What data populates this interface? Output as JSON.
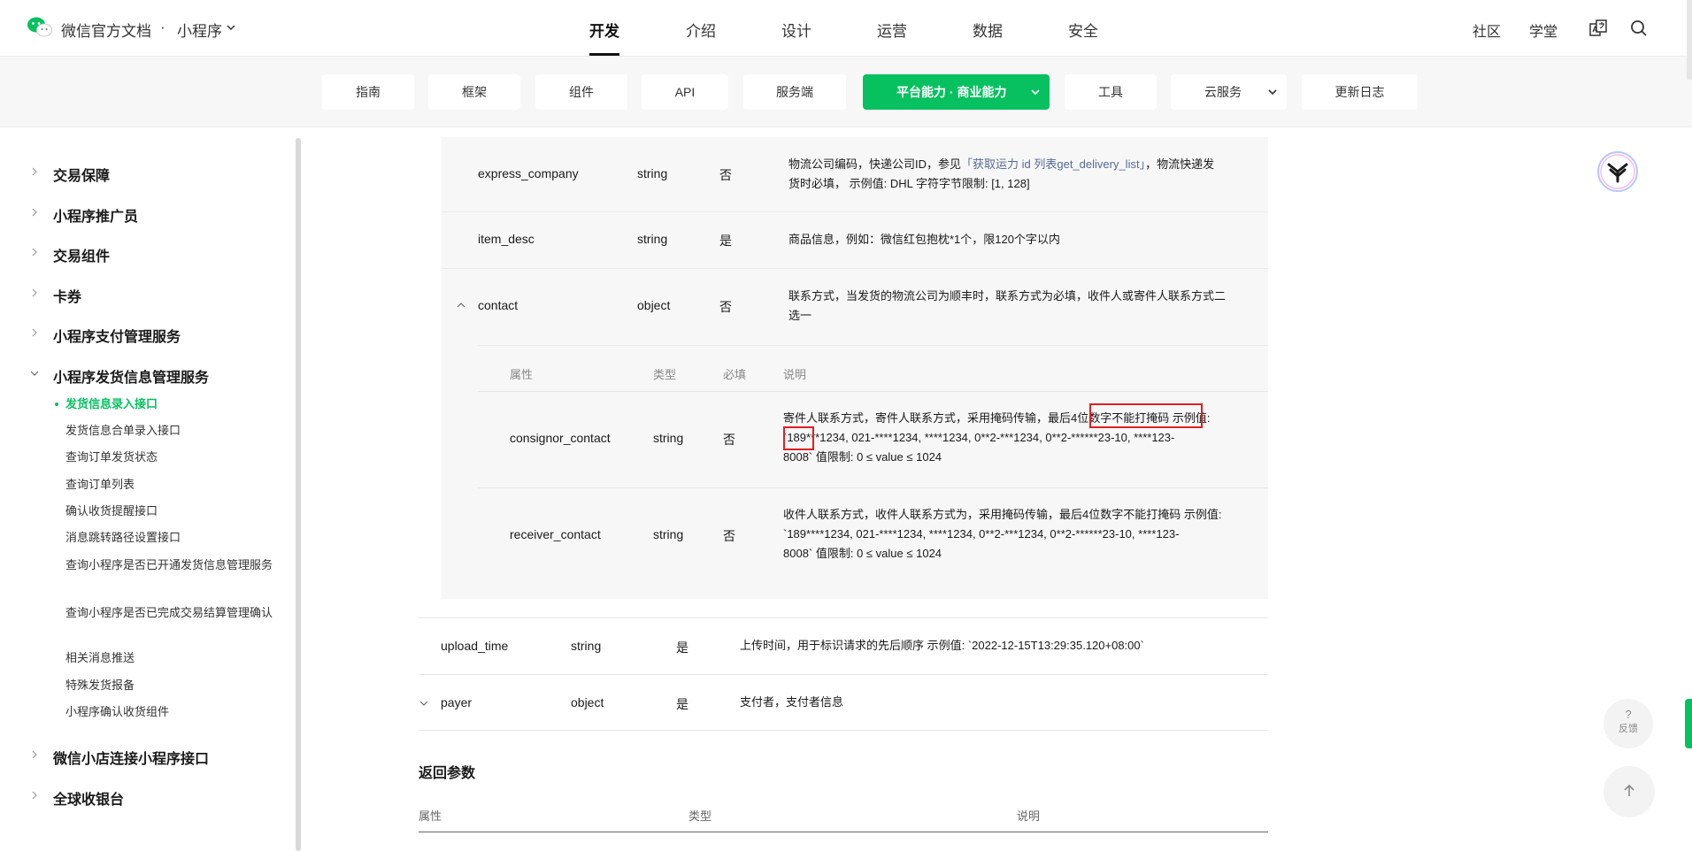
{
  "header": {
    "brand": "微信官方文档",
    "separator": "·",
    "product": "小程序",
    "nav": [
      {
        "label": "开发",
        "active": true
      },
      {
        "label": "介绍"
      },
      {
        "label": "设计"
      },
      {
        "label": "运营"
      },
      {
        "label": "数据"
      },
      {
        "label": "安全"
      }
    ],
    "right_links": [
      "社区",
      "学堂"
    ],
    "icons": [
      "translate-icon",
      "search-icon"
    ]
  },
  "subnav": [
    {
      "label": "指南"
    },
    {
      "label": "框架"
    },
    {
      "label": "组件"
    },
    {
      "label": "API"
    },
    {
      "label": "服务端"
    },
    {
      "label": "平台能力 · 商业能力",
      "active": true,
      "dropdown": true
    },
    {
      "label": "工具"
    },
    {
      "label": "云服务",
      "dropdown": true
    },
    {
      "label": "更新日志"
    }
  ],
  "sidebar": {
    "sections": [
      {
        "label": "交易保障"
      },
      {
        "label": "小程序推广员"
      },
      {
        "label": "交易组件"
      },
      {
        "label": "卡券"
      },
      {
        "label": "小程序支付管理服务"
      },
      {
        "label": "小程序发货信息管理服务",
        "expanded": true
      }
    ],
    "sub_items": [
      {
        "label": "发货信息录入接口",
        "active": true
      },
      {
        "label": "发货信息合单录入接口"
      },
      {
        "label": "查询订单发货状态"
      },
      {
        "label": "查询订单列表"
      },
      {
        "label": "确认收货提醒接口"
      },
      {
        "label": "消息跳转路径设置接口"
      },
      {
        "label": "查询小程序是否已开通发货信息管理服务"
      },
      {
        "label": "查询小程序是否已完成交易结算管理确认"
      },
      {
        "label": "相关消息推送"
      },
      {
        "label": "特殊发货报备"
      },
      {
        "label": "小程序确认收货组件"
      }
    ],
    "after_sections": [
      {
        "label": "微信小店连接小程序接口"
      },
      {
        "label": "全球收银台"
      }
    ]
  },
  "table": {
    "rows": [
      {
        "name": "express_company",
        "type": "string",
        "required": "否",
        "desc_pre": "物流公司编码，快递公司ID，参见",
        "desc_link": "「获取运力 id 列表get_delivery_list」",
        "desc_post": "，物流快递发",
        "desc_line2": "货时必填， 示例值: DHL 字符字节限制: [1, 128]"
      },
      {
        "name": "item_desc",
        "type": "string",
        "required": "是",
        "desc": "商品信息，例如：微信红包抱枕*1个，限120个字以内"
      },
      {
        "name": "contact",
        "type": "object",
        "required": "否",
        "desc_line1": "联系方式，当发货的物流公司为顺丰时，联系方式为必填，收件人或寄件人联系方式二",
        "desc_line2": "选一"
      }
    ],
    "nested_headers": [
      "属性",
      "类型",
      "必填",
      "说明"
    ],
    "nested_rows": [
      {
        "name": "consignor_contact",
        "type": "string",
        "required": "否",
        "desc_line1_a": "寄件人联系方式，寄件人联系方式，采用掩码传输，最后",
        "desc_line1_highlight": "4位数字不能打掩码",
        "desc_line1_b": " 示例值:",
        "desc_line2_highlight": "`189",
        "desc_line2_rest": "***1234, 021-****1234, ****1234, 0**2-***1234, 0**2-******23-10, ****123-",
        "desc_line3": "8008` 值限制: 0 ≤ value ≤ 1024"
      },
      {
        "name": "receiver_contact",
        "type": "string",
        "required": "否",
        "desc_line1": "收件人联系方式，收件人联系方式为，采用掩码传输，最后4位数字不能打掩码 示例值:",
        "desc_line2": "`189****1234, 021-****1234, ****1234, 0**2-***1234, 0**2-******23-10, ****123-",
        "desc_line3": "8008` 值限制: 0 ≤ value ≤ 1024"
      }
    ],
    "outer_rows": [
      {
        "name": "upload_time",
        "type": "string",
        "required": "是",
        "desc": "上传时间，用于标识请求的先后顺序 示例值: `2022-12-15T13:29:35.120+08:00`"
      },
      {
        "name": "payer",
        "type": "object",
        "required": "是",
        "desc": "支付者，支付者信息"
      }
    ]
  },
  "return_params": {
    "title": "返回参数",
    "headers": [
      "属性",
      "类型",
      "说明"
    ]
  },
  "widgets": {
    "feedback_q": "?",
    "feedback_label": "反馈"
  },
  "colors": {
    "accent": "#07c160",
    "link": "#576b95",
    "highlight_box": "#e02020"
  }
}
